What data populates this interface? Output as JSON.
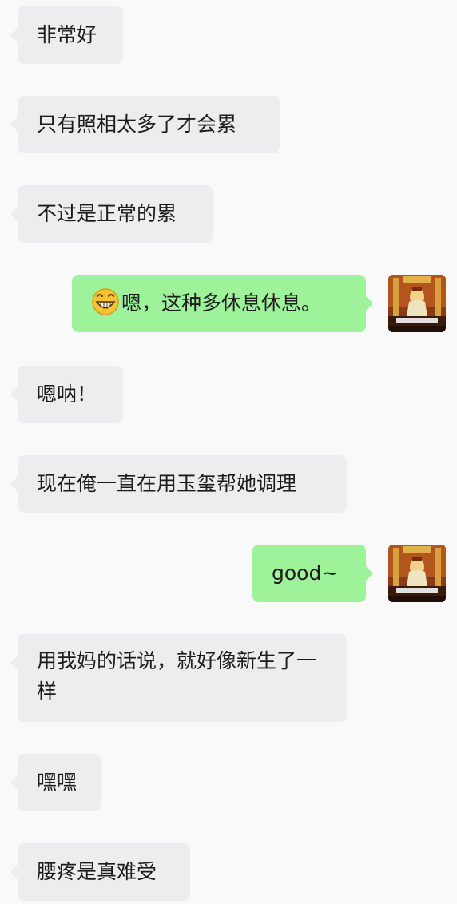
{
  "messages": [
    {
      "side": "incoming",
      "text": "非常好"
    },
    {
      "side": "incoming",
      "text": "只有照相太多了才会累"
    },
    {
      "side": "incoming",
      "text": "不过是正常的累"
    },
    {
      "side": "outgoing",
      "emoji": "grinning-face-emoji",
      "text": "嗯，这种多休息休息。"
    },
    {
      "side": "incoming",
      "text": "嗯呐！"
    },
    {
      "side": "incoming",
      "text": "现在俺一直在用玉玺帮她调理"
    },
    {
      "side": "outgoing",
      "text": "good~"
    },
    {
      "side": "incoming",
      "text": "用我妈的话说，就好像新生了一样"
    },
    {
      "side": "incoming",
      "text": "嘿嘿"
    },
    {
      "side": "incoming",
      "text": "腰疼是真难受"
    }
  ],
  "colors": {
    "background": "#f9f9f9",
    "incoming_bubble": "#ededef",
    "outgoing_bubble": "#9ef29a",
    "text": "#1c1c1c"
  },
  "icons": {
    "avatar": "user-avatar",
    "emoji": "grinning-face-emoji"
  }
}
